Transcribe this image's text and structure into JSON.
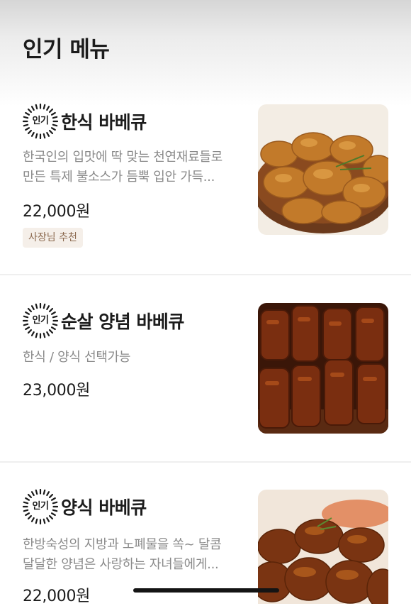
{
  "header": {
    "title": "인기 메뉴"
  },
  "menu": {
    "items": [
      {
        "badge": "인기",
        "name": "한식 바베큐",
        "description_lines": [
          "한국인의 입맛에 딱 맞는 천연재료들로",
          "만든 특제 불소스가 듬뿍 입안 가득..."
        ],
        "price": "22,000원",
        "tag": "사장님 추천"
      },
      {
        "badge": "인기",
        "name": "순살 양념 바베큐",
        "description_lines": [
          "한식 / 양식 선택가능"
        ],
        "price": "23,000원"
      },
      {
        "badge": "인기",
        "name": "양식 바베큐",
        "description_lines": [
          "한방숙성의 지방과 노폐물을 쏙~ 달콤",
          "달달한 양념은 사랑하는 자녀들에게..."
        ],
        "price": "22,000원"
      }
    ]
  },
  "colors": {
    "text": "#1c1c1c",
    "muted": "#8a8a8a",
    "tag_bg": "#f5efe9",
    "tag_text": "#8c6a50",
    "divider": "#efefef"
  },
  "icons": {
    "badge": "popular-starburst-icon"
  }
}
